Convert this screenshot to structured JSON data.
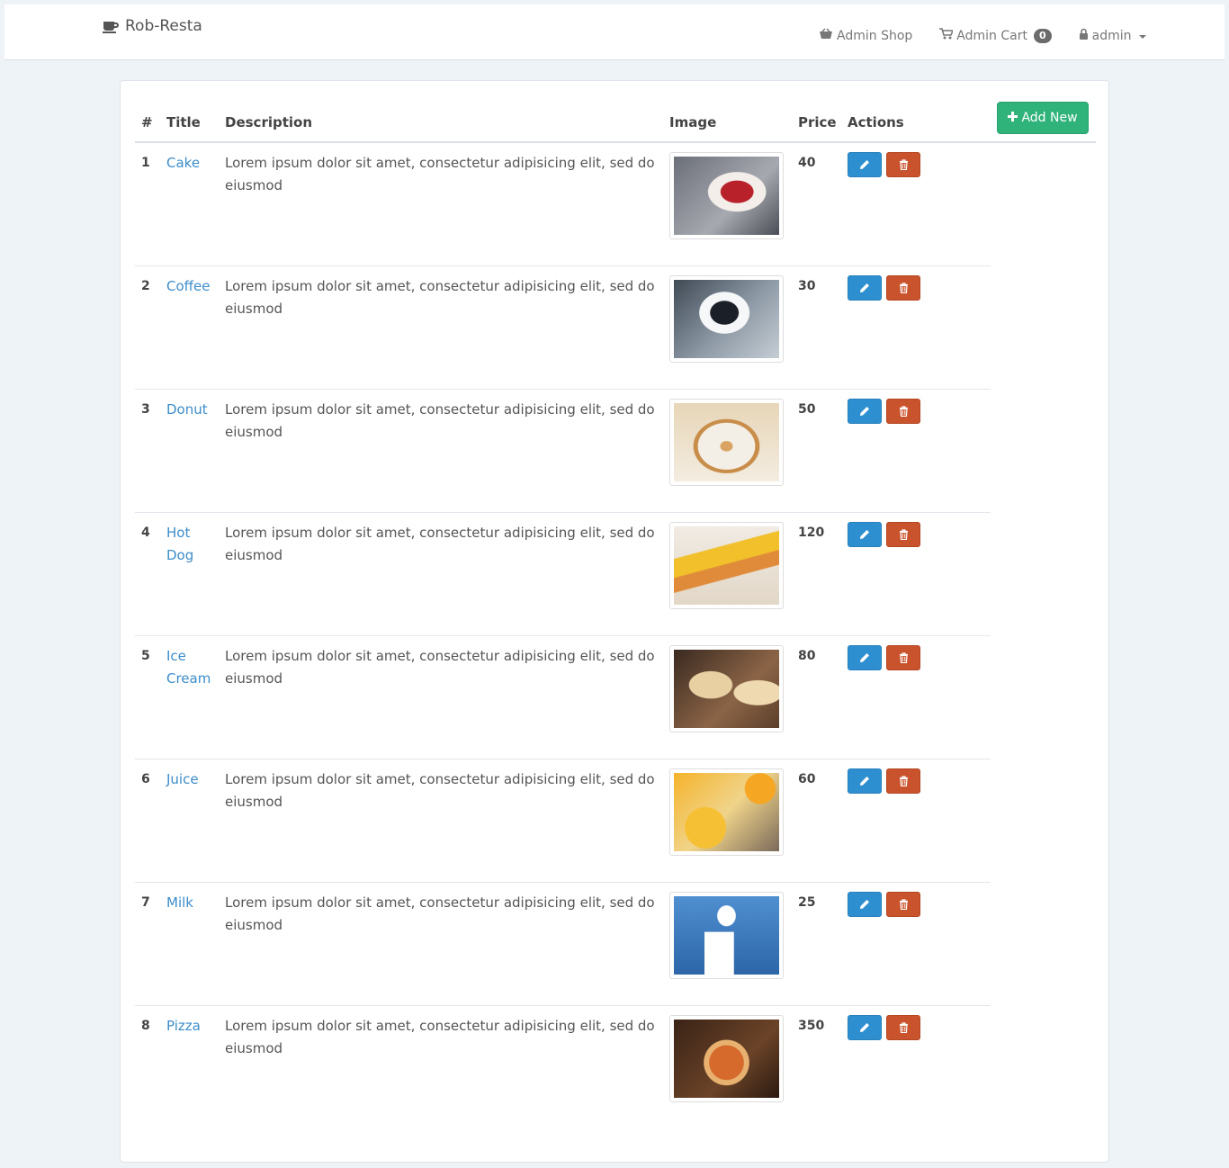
{
  "nav": {
    "brand": "Rob-Resta",
    "shop": "Admin Shop",
    "cart": "Admin Cart",
    "cart_count": "0",
    "user": "admin"
  },
  "table": {
    "add_label": "Add New",
    "headers": [
      "#",
      "Title",
      "Description",
      "Image",
      "Price",
      "Actions"
    ],
    "rows": [
      {
        "num": "1",
        "title": "Cake",
        "desc": "Lorem ipsum dolor sit amet, consectetur adipisicing elit, sed do eiusmod",
        "price": "40",
        "image": "cake"
      },
      {
        "num": "2",
        "title": "Coffee",
        "desc": "Lorem ipsum dolor sit amet, consectetur adipisicing elit, sed do eiusmod",
        "price": "30",
        "image": "coffee"
      },
      {
        "num": "3",
        "title": "Donut",
        "desc": "Lorem ipsum dolor sit amet, consectetur adipisicing elit, sed do eiusmod",
        "price": "50",
        "image": "donut"
      },
      {
        "num": "4",
        "title": "Hot Dog",
        "desc": "Lorem ipsum dolor sit amet, consectetur adipisicing elit, sed do eiusmod",
        "price": "120",
        "image": "hotdog"
      },
      {
        "num": "5",
        "title": "Ice Cream",
        "desc": "Lorem ipsum dolor sit amet, consectetur adipisicing elit, sed do eiusmod",
        "price": "80",
        "image": "icecream"
      },
      {
        "num": "6",
        "title": "Juice",
        "desc": "Lorem ipsum dolor sit amet, consectetur adipisicing elit, sed do eiusmod",
        "price": "60",
        "image": "juice"
      },
      {
        "num": "7",
        "title": "Milk",
        "desc": "Lorem ipsum dolor sit amet, consectetur adipisicing elit, sed do eiusmod",
        "price": "25",
        "image": "milk"
      },
      {
        "num": "8",
        "title": "Pizza",
        "desc": "Lorem ipsum dolor sit amet, consectetur adipisicing elit, sed do eiusmod",
        "price": "350",
        "image": "pizza"
      }
    ]
  },
  "colors": {
    "accent_link": "#3c8dca",
    "add_button": "#2fb37a",
    "edit_button": "#2e8fd0",
    "delete_button": "#c9532d"
  },
  "icons": {
    "brand": "coffee-cup-icon",
    "shop": "basket-icon",
    "cart": "cart-icon",
    "user": "lock-icon",
    "add": "plus-icon",
    "edit": "pencil-icon",
    "delete": "trash-icon"
  }
}
